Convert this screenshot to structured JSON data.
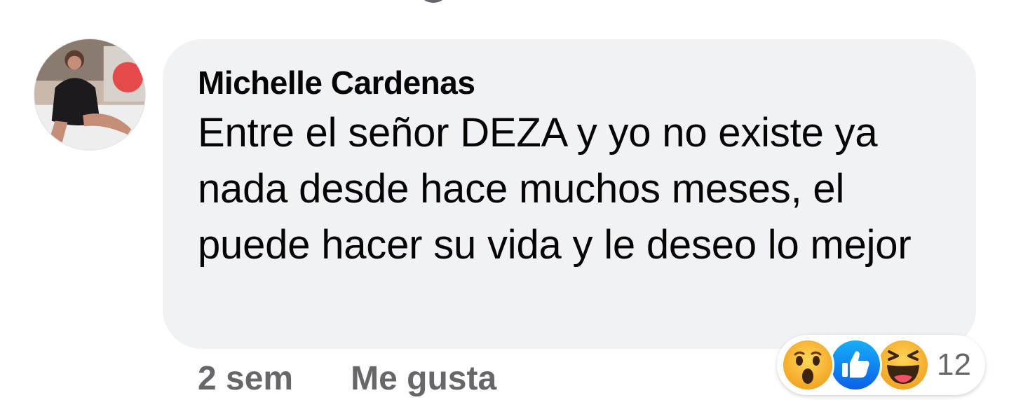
{
  "comment": {
    "author": "Michelle Cardenas",
    "text": "Entre el señor DEZA y yo no existe ya nada desde hace muchos meses, el puede hacer su vida y le deseo lo mejor",
    "time": "2 sem",
    "like_label": "Me gusta"
  },
  "reactions": {
    "icons": [
      "wow-reaction-icon",
      "like-reaction-icon",
      "haha-reaction-icon"
    ],
    "count": "12"
  },
  "colors": {
    "bubble": "#f0f2f5",
    "text": "#050505",
    "secondary": "#65676b",
    "like_blue": "#1877f2",
    "emoji_yellow": "#f7b125"
  }
}
